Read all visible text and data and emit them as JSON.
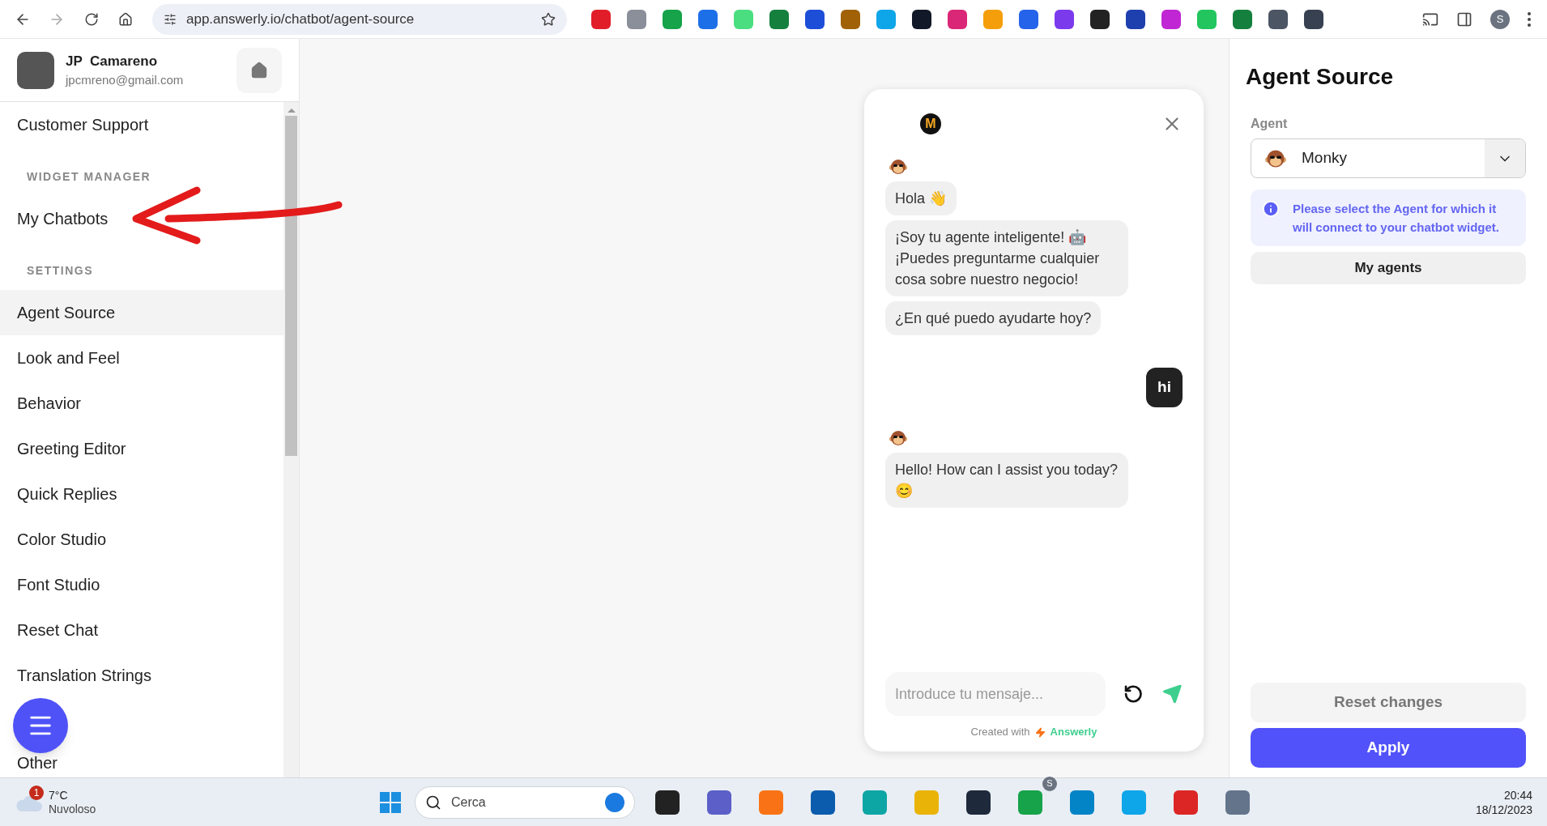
{
  "browser": {
    "url": "app.answerly.io/chatbot/agent-source",
    "profile_initial": "S"
  },
  "sidebar": {
    "user": {
      "name": "JP  Camareno",
      "email": "jpcmreno@gmail.com"
    },
    "items": [
      {
        "kind": "item",
        "label": "Customer Support",
        "selected": false
      },
      {
        "kind": "heading",
        "label": "WIDGET MANAGER"
      },
      {
        "kind": "item",
        "label": "My Chatbots",
        "selected": false
      },
      {
        "kind": "heading",
        "label": "SETTINGS"
      },
      {
        "kind": "item",
        "label": "Agent Source",
        "selected": true
      },
      {
        "kind": "item",
        "label": "Look and Feel",
        "selected": false
      },
      {
        "kind": "item",
        "label": "Behavior",
        "selected": false
      },
      {
        "kind": "item",
        "label": "Greeting Editor",
        "selected": false
      },
      {
        "kind": "item",
        "label": "Quick Replies",
        "selected": false
      },
      {
        "kind": "item",
        "label": "Color Studio",
        "selected": false
      },
      {
        "kind": "item",
        "label": "Font Studio",
        "selected": false
      },
      {
        "kind": "item",
        "label": "Reset Chat",
        "selected": false
      },
      {
        "kind": "item",
        "label": "Translation Strings",
        "selected": false
      },
      {
        "kind": "spacer"
      },
      {
        "kind": "item",
        "label": "Other",
        "selected": false
      }
    ]
  },
  "chat": {
    "logo_letter": "M",
    "messages": [
      {
        "kind": "bot",
        "avatar": true,
        "text": "Hola 👋"
      },
      {
        "kind": "bot",
        "avatar": false,
        "text": "¡Soy tu agente inteligente! 🤖 ¡Puedes preguntarme cualquier cosa sobre nuestro negocio!"
      },
      {
        "kind": "bot",
        "avatar": false,
        "text": "¿En qué puedo ayudarte hoy?"
      },
      {
        "kind": "user",
        "text": "hi"
      },
      {
        "kind": "bot",
        "avatar": true,
        "text": "Hello! How can I assist you today? 😊"
      }
    ],
    "input": {
      "placeholder": "Introduce tu mensaje..."
    },
    "footer": {
      "prefix": "Created with",
      "brand": "Answerly"
    }
  },
  "panel": {
    "title": "Agent Source",
    "agent_label": "Agent",
    "agent": "Monky",
    "info": "Please select the Agent for which it will connect to your chatbot widget.",
    "my_agents": "My agents",
    "reset": "Reset changes",
    "apply": "Apply"
  },
  "taskbar": {
    "notification_count": "1",
    "temperature": "7°C",
    "weather": "Nuvoloso",
    "search_placeholder": "Cerca",
    "chrome_badge": "S",
    "time": "20:44",
    "date": "18/12/2023"
  }
}
